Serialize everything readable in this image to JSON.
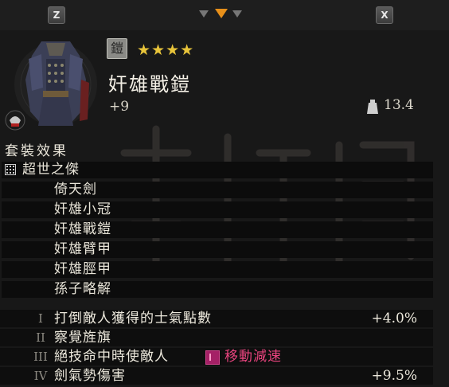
{
  "keys": {
    "left": "Z",
    "right": "X"
  },
  "item": {
    "name": "奸雄戰鎧",
    "upgrade": "+9",
    "weight": "13.4",
    "stars": "★★★★",
    "rarity_stars": 4
  },
  "set_effects": {
    "title": "套裝效果",
    "set_name": "超世之傑",
    "pieces": [
      "倚天劍",
      "奸雄小冠",
      "奸雄戰鎧",
      "奸雄臂甲",
      "奸雄脛甲",
      "孫子略解"
    ]
  },
  "bonuses": [
    {
      "numeral": "I",
      "text": "打倒敵人獲得的士氣點數",
      "value": "+4.0%"
    },
    {
      "numeral": "II",
      "text": "察覺旌旗",
      "value": ""
    },
    {
      "numeral": "III",
      "text": "絕技命中時使敵人",
      "value": "",
      "effect": "移動減速"
    },
    {
      "numeral": "IV",
      "text": "劍氣勢傷害",
      "value": "+9.5%"
    }
  ],
  "icons": {
    "set": "set-armor-icon",
    "weight": "weight-icon",
    "grid": "set-grid-icon",
    "badge": "skull-helmet-icon",
    "slow": "slow-status-icon"
  },
  "colors": {
    "star": "#e8c43a",
    "accent": "#e8901a",
    "status_effect": "#e8447e"
  }
}
